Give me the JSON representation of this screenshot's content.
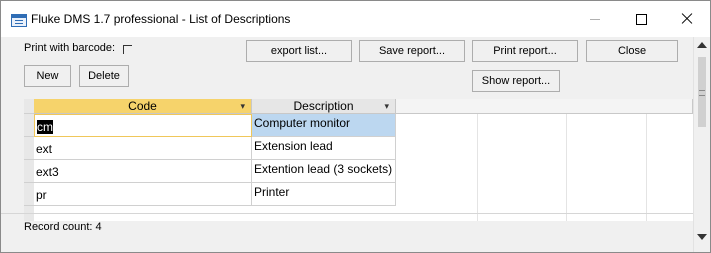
{
  "window": {
    "title": "Fluke DMS 1.7 professional - List of Descriptions",
    "icon": "form-window-icon"
  },
  "form": {
    "barcode_label": "Print with barcode:",
    "barcode_checked": false,
    "buttons": {
      "export": "export list...",
      "save": "Save report...",
      "print": "Print report...",
      "close": "Close",
      "new": "New",
      "delete": "Delete",
      "show": "Show report..."
    }
  },
  "grid": {
    "columns": [
      "Code",
      "Description"
    ],
    "rows": [
      {
        "code": "cm",
        "description": "Computer monitor"
      },
      {
        "code": "ext",
        "description": "Extension lead"
      },
      {
        "code": "ext3",
        "description": "Extention lead (3 sockets)"
      },
      {
        "code": "pr",
        "description": "Printer"
      }
    ]
  },
  "status": {
    "record_count": "Record count:  4"
  },
  "colors": {
    "active_header": "#f6d36b",
    "selected_cell": "#bcd7f0"
  }
}
